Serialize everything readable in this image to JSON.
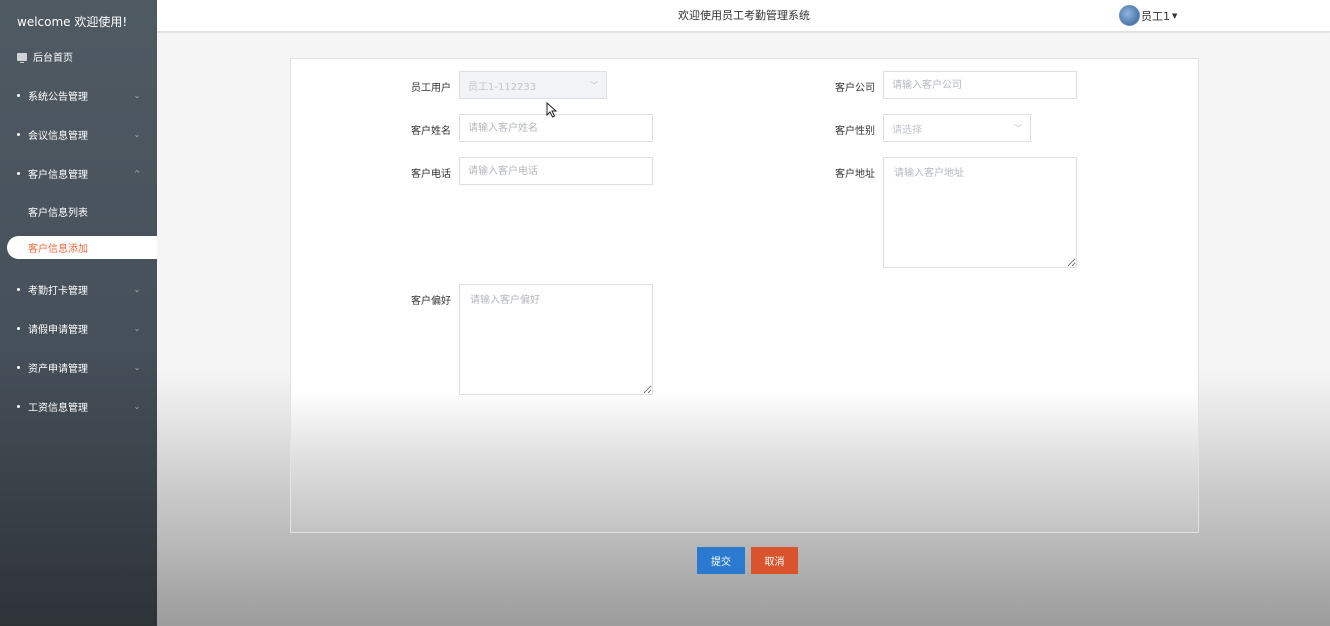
{
  "sidebar": {
    "welcome": "welcome 欢迎使用!",
    "home": "后台首页",
    "menus": [
      {
        "label": "系统公告管理",
        "chevron": "⌄"
      },
      {
        "label": "会议信息管理",
        "chevron": "⌄"
      },
      {
        "label": "客户信息管理",
        "chevron": "^"
      },
      {
        "label": "考勤打卡管理",
        "chevron": "⌄"
      },
      {
        "label": "请假申请管理",
        "chevron": "⌄"
      },
      {
        "label": "资产申请管理",
        "chevron": "⌄"
      },
      {
        "label": "工资信息管理",
        "chevron": "⌄"
      }
    ],
    "sub_list": "客户信息列表",
    "sub_add": "客户信息添加"
  },
  "header": {
    "title": "欢迎使用员工考勤管理系统",
    "user": "员工1"
  },
  "form": {
    "employee_label": "员工用户",
    "employee_value": "员工1-112233",
    "company_label": "客户公司",
    "company_placeholder": "请输入客户公司",
    "name_label": "客户姓名",
    "name_placeholder": "请输入客户姓名",
    "gender_label": "客户性别",
    "gender_placeholder": "请选择",
    "phone_label": "客户电话",
    "phone_placeholder": "请输入客户电话",
    "address_label": "客户地址",
    "address_placeholder": "请输入客户地址",
    "pref_label": "客户偏好",
    "pref_placeholder": "请输入客户偏好"
  },
  "buttons": {
    "submit": "提交",
    "cancel": "取消"
  },
  "colors": {
    "sidebar": "#4f5a63",
    "active": "#f06b3b",
    "submit": "#2a7ad0",
    "cancel": "#d9542c"
  }
}
